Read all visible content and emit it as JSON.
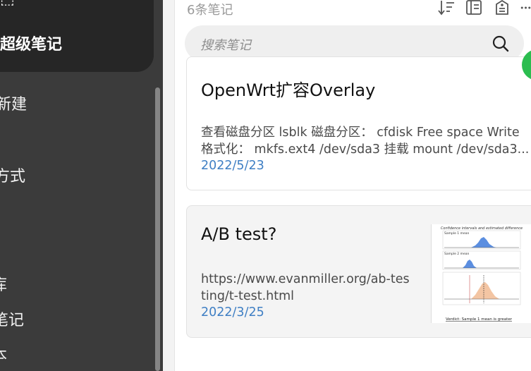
{
  "sidebar": {
    "partial_top": "⬚",
    "super_notes_label": "超级笔记",
    "items": [
      {
        "label": "新建"
      },
      {
        "label": "方式"
      },
      {
        "label": "库"
      },
      {
        "label": "笔记"
      },
      {
        "label": "本"
      }
    ]
  },
  "notes_list": {
    "count_label": "6条笔记",
    "search_placeholder": "搜索笔记",
    "icons": [
      "sort-icon",
      "view-layout-icon",
      "note-tag-icon",
      "more-icon"
    ],
    "cards": [
      {
        "title": "OpenWrt扩容Overlay",
        "desc_line1": "查看磁盘分区 lsblk 磁盘分区： cfdisk Free space Write",
        "desc_line2": "格式化： mkfs.ext4 /dev/sda3 挂载 mount /dev/sda3...",
        "date": "2022/5/23"
      },
      {
        "title": "A/B test?",
        "desc_line1": "https://www.evanmiller.org/ab-tes",
        "desc_line2": "ting/t-test.html",
        "date": "2022/3/25",
        "thumbnail": {
          "heading": "Confidence intervals and estimated difference",
          "panel1_label": "Sample 1 mean",
          "panel2_label": "Sample 2 mean",
          "footer": "Verdict: Sample 1 mean is greater"
        }
      }
    ]
  },
  "colors": {
    "sidebar_bg": "#3b3b3b",
    "sidebar_top_bg": "#262626",
    "date_blue": "#3f7fc4",
    "accent_green": "#2bbd4f"
  }
}
